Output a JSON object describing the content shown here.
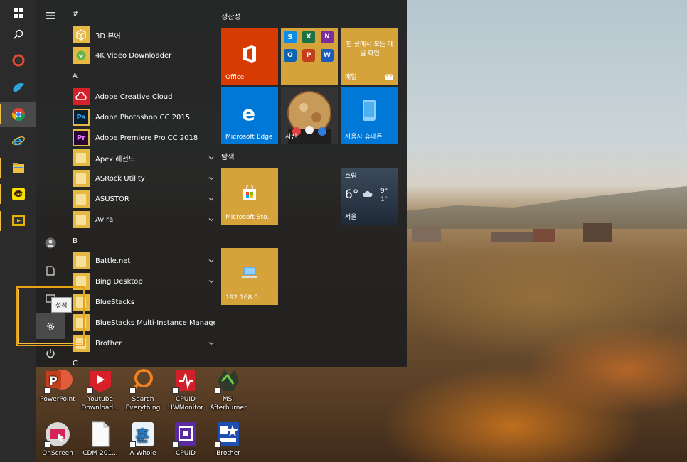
{
  "taskbar": {
    "icons": [
      "windows-logo-icon",
      "search-icon",
      "app-icon",
      "app-icon",
      "chrome-icon",
      "edge-icon",
      "file-explorer-icon",
      "kakaotalk-icon",
      "app-icon"
    ]
  },
  "tooltip": "설정",
  "applist": {
    "letters": {
      "hash": "#",
      "a": "A",
      "b": "B",
      "c": "C"
    },
    "apps": [
      {
        "label": "3D 뷰어",
        "expandable": false
      },
      {
        "label": "4K Video Downloader",
        "expandable": false
      },
      {
        "label": "Adobe Creative Cloud",
        "expandable": false
      },
      {
        "label": "Adobe Photoshop CC 2015",
        "icon_text": "Ps",
        "expandable": false
      },
      {
        "label": "Adobe Premiere Pro CC 2018",
        "icon_text": "Pr",
        "expandable": false
      },
      {
        "label": "Apex 레전드",
        "expandable": true
      },
      {
        "label": "ASRock Utility",
        "expandable": true
      },
      {
        "label": "ASUSTOR",
        "expandable": true
      },
      {
        "label": "Avira",
        "expandable": true
      },
      {
        "label": "Battle.net",
        "expandable": true
      },
      {
        "label": "Bing Desktop",
        "expandable": true
      },
      {
        "label": "BlueStacks",
        "expandable": false
      },
      {
        "label": "BlueStacks Multi-Instance Manager",
        "expandable": false
      },
      {
        "label": "Brother",
        "expandable": true
      }
    ]
  },
  "tiles": {
    "groups": {
      "productivity": "생산성",
      "explore": "탐색"
    },
    "office": "Office",
    "mail_text": "한 곳에서 모든 메일 확인",
    "mail_label": "메일",
    "edge": "Microsoft Edge",
    "photos": "사진",
    "phone": "사용자 휴대폰",
    "store": "Microsoft Sto...",
    "weather": {
      "condition": "흐림",
      "temp": "6°",
      "high": "9°",
      "low": "1°",
      "city": "서울"
    },
    "network": "192.168.0"
  },
  "desktop": [
    {
      "label": "PowerPoint"
    },
    {
      "label": "Youtube Download..."
    },
    {
      "label": "Search Everything"
    },
    {
      "label": "CPUID HWMonitor"
    },
    {
      "label": "MSI Afterburner"
    },
    {
      "label": "OnScreen"
    },
    {
      "label": "CDM 201..."
    },
    {
      "label": "A Whole"
    },
    {
      "label": "CPUID"
    },
    {
      "label": "Brother"
    }
  ],
  "colors": {
    "accent": "#d6a23a",
    "office": "#d83b01",
    "edge": "#0078d7",
    "highlight": "#e8a218"
  }
}
